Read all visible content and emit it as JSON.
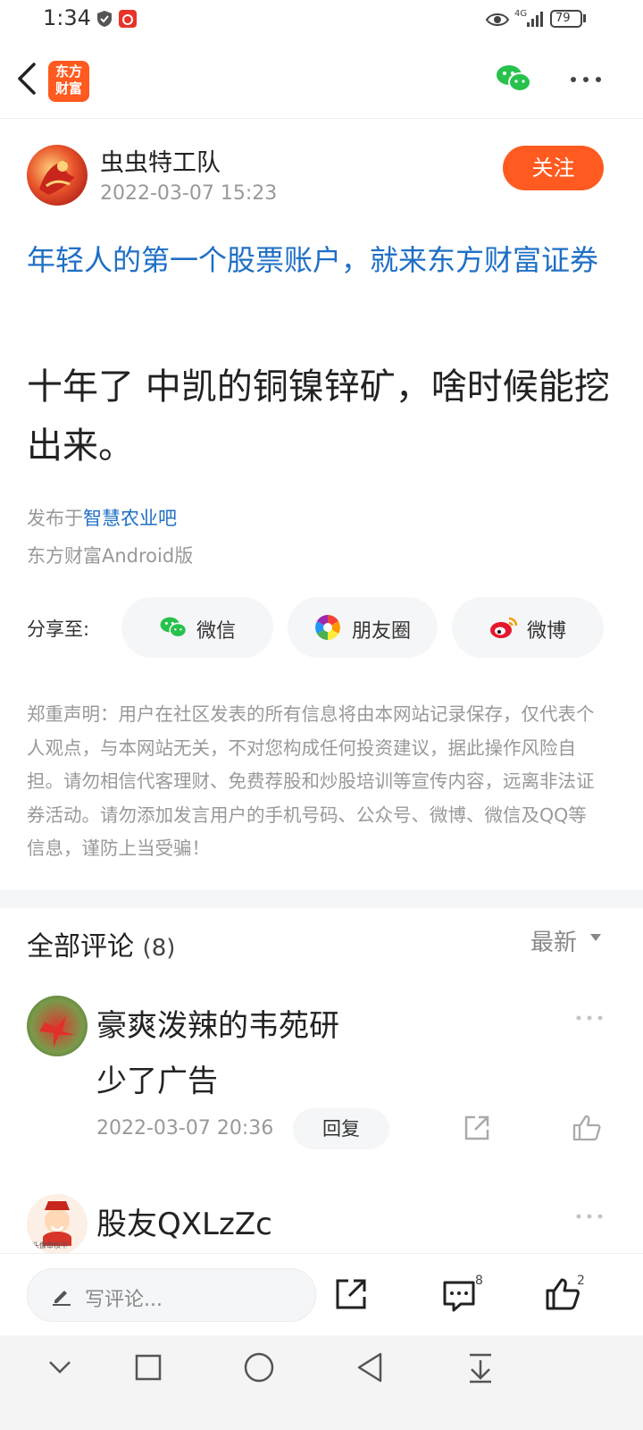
{
  "status_bar": {
    "time": "1:34",
    "network": "4G",
    "battery": "79"
  },
  "header": {
    "logo_text_line1": "东方",
    "logo_text_line2": "财富",
    "icons": [
      "back-arrow-icon",
      "wechat-icon",
      "more-icon"
    ]
  },
  "post": {
    "author": "虫虫特工队",
    "time": "2022-03-07 15:23",
    "follow_label": "关注",
    "promo": "年轻人的第一个股票账户，就来东方财富证券",
    "content": "十年了 中凯的铜镍锌矿，啥时候能挖出来。",
    "posted_in_prefix": "发布于",
    "bar_name": "智慧农业吧",
    "client": "东方财富Android版"
  },
  "share": {
    "label": "分享至:",
    "buttons": [
      {
        "label": "微信",
        "icon": "wechat-icon"
      },
      {
        "label": "朋友圈",
        "icon": "moments-icon"
      },
      {
        "label": "微博",
        "icon": "weibo-icon"
      }
    ]
  },
  "disclaimer": "郑重声明：用户在社区发表的所有信息将由本网站记录保存，仅代表个人观点，与本网站无关，不对您构成任何投资建议，据此操作风险自担。请勿相信代客理财、免费荐股和炒股培训等宣传内容，远离非法证券活动。请勿添加发言用户的手机号码、公众号、微博、微信及QQ等信息，谨防上当受骗！",
  "comments": {
    "title": "全部评论",
    "count": "(8)",
    "sort": "最新",
    "items": [
      {
        "user": "豪爽泼辣的韦苑研",
        "text": "少了广告",
        "time": "2022-03-07 20:36",
        "reply_label": "回复"
      },
      {
        "user": "股友QXLzZc",
        "avatar_caption": "头像审核中"
      }
    ]
  },
  "bottom_bar": {
    "input_placeholder": "写评论...",
    "comment_count": "8",
    "like_count": "2"
  },
  "colors": {
    "accent": "#ff5a1f",
    "link": "#1e6fc6",
    "muted": "#999999"
  }
}
